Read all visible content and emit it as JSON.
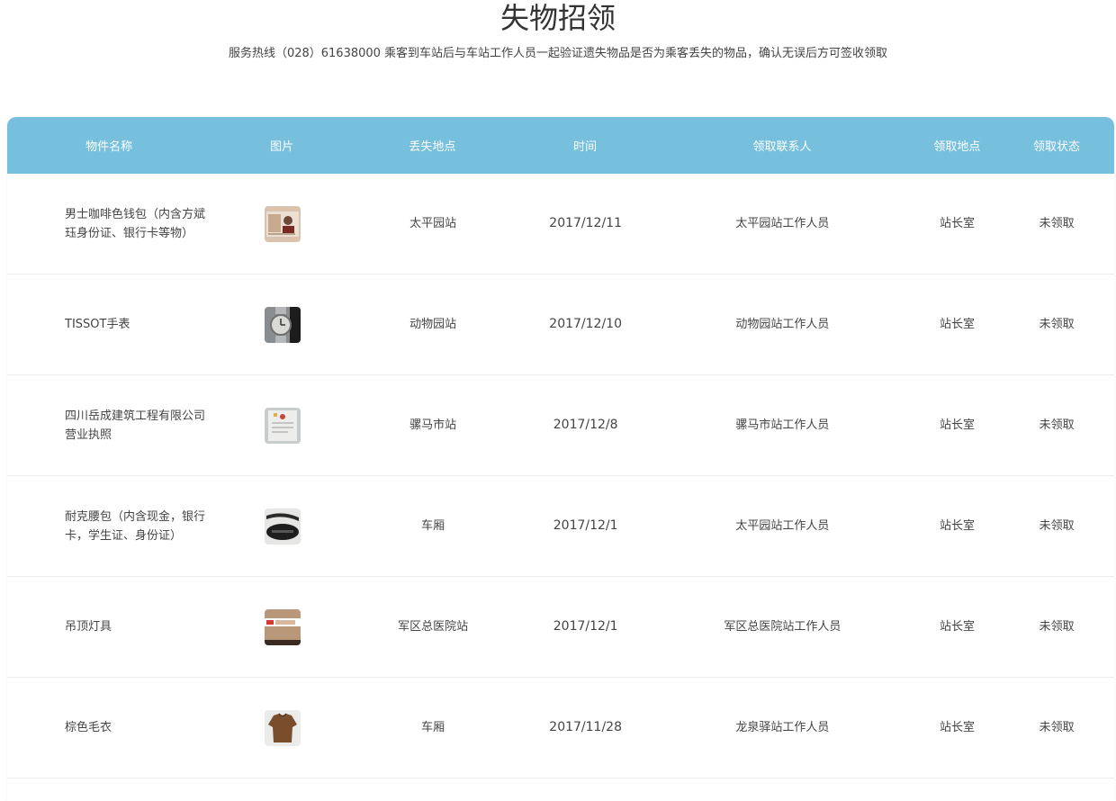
{
  "header": {
    "title": "失物招领",
    "subtitle": "服务热线（028）61638000 乘客到车站后与车站工作人员一起验证遗失物品是否为乘客丢失的物品，确认无误后方可签收领取"
  },
  "table": {
    "columns": [
      "物件名称",
      "图片",
      "丢失地点",
      "时间",
      "领取联系人",
      "领取地点",
      "领取状态"
    ],
    "header_color": "#76bfdd",
    "rows": [
      {
        "name": "男士咖啡色钱包（内含方斌珏身份证、银行卡等物）",
        "thumb_icon": "id-card-photo-icon",
        "location": "太平园站",
        "time": "2017/12/11",
        "contact": "太平园站工作人员",
        "pickup": "站长室",
        "status": "未领取"
      },
      {
        "name": "TISSOT手表",
        "thumb_icon": "watch-photo-icon",
        "location": "动物园站",
        "time": "2017/12/10",
        "contact": "动物园站工作人员",
        "pickup": "站长室",
        "status": "未领取"
      },
      {
        "name": "四川岳成建筑工程有限公司营业执照",
        "thumb_icon": "business-license-photo-icon",
        "location": "骡马市站",
        "time": "2017/12/8",
        "contact": "骡马市站工作人员",
        "pickup": "站长室",
        "status": "未领取"
      },
      {
        "name": "耐克腰包（内含现金，银行卡，学生证、身份证）",
        "thumb_icon": "waist-bag-photo-icon",
        "location": "车厢",
        "time": "2017/12/1",
        "contact": "太平园站工作人员",
        "pickup": "站长室",
        "status": "未领取"
      },
      {
        "name": "吊顶灯具",
        "thumb_icon": "lamp-box-photo-icon",
        "location": "军区总医院站",
        "time": "2017/12/1",
        "contact": "军区总医院站工作人员",
        "pickup": "站长室",
        "status": "未领取"
      },
      {
        "name": "棕色毛衣",
        "thumb_icon": "sweater-photo-icon",
        "location": "车厢",
        "time": "2017/11/28",
        "contact": "龙泉驿站工作人员",
        "pickup": "站长室",
        "status": "未领取"
      }
    ]
  }
}
